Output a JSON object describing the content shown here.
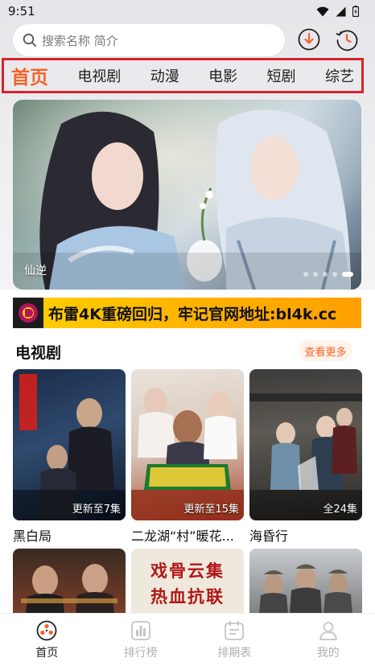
{
  "status_bar": {
    "time": "9:51"
  },
  "search": {
    "placeholder": "搜索名称 简介"
  },
  "tabs": [
    {
      "label": "首页",
      "active": true
    },
    {
      "label": "电视剧",
      "active": false
    },
    {
      "label": "动漫",
      "active": false
    },
    {
      "label": "电影",
      "active": false
    },
    {
      "label": "短剧",
      "active": false
    },
    {
      "label": "综艺",
      "active": false
    }
  ],
  "banner": {
    "title": "仙逆",
    "dot_count": 5,
    "active_dot": 4
  },
  "ad": {
    "text": "布雷4K重磅回归，牢记官网地址:bl4k.cc"
  },
  "section": {
    "title": "电视剧",
    "more_label": "查看更多",
    "items": [
      {
        "title": "黑白局",
        "badge": "更新至7集"
      },
      {
        "title": "二龙湖“村”暖花...",
        "badge": "更新至15集"
      },
      {
        "title": "海昏行",
        "badge": "全24集"
      }
    ],
    "next_row_poster_texts": [
      "戏骨云集",
      "热血抗联"
    ]
  },
  "bottom_nav": [
    {
      "label": "首页",
      "icon": "film-reel-icon",
      "active": true
    },
    {
      "label": "排行榜",
      "icon": "bar-chart-icon",
      "active": false
    },
    {
      "label": "排期表",
      "icon": "calendar-icon",
      "active": false
    },
    {
      "label": "我的",
      "icon": "user-icon",
      "active": false
    }
  ],
  "colors": {
    "accent": "#f2642a",
    "highlight_border": "#d9232d",
    "ad_yellow": "#ffc800"
  }
}
